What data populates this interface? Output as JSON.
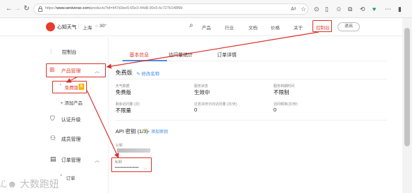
{
  "browser": {
    "url_prefix": "https://",
    "url_host": "www.seniverse.com",
    "url_path": "/products?id=447d3ee5-65e3-44d8-90c5-6c727b148f9b",
    "icons": [
      "back-icon",
      "forward-icon",
      "refresh-icon",
      "home-icon",
      "read-aloud-icon",
      "favorite-icon",
      "extension-icon",
      "split-screen-icon",
      "favorites-bar-icon",
      "collections-icon",
      "history-icon",
      "performance-icon",
      "more-icon",
      "sidebar-icon"
    ]
  },
  "header": {
    "logo_text": "心知天气",
    "separator": "|",
    "city": "上海",
    "weather_glyph": "☼",
    "temperature": "30°",
    "nav": [
      "产品",
      "行业",
      "文档",
      "价格",
      "关于",
      "控制台"
    ],
    "logout": "退出"
  },
  "sidebar": {
    "console": "控制台",
    "product_mgmt": "产品管理",
    "free_plan": "免费版",
    "free_badge": "免",
    "add_product": "+ 添加产品",
    "auth_upgrade": "认证升级",
    "members": "成员管理",
    "order_mgmt": "订单管理",
    "orders": "订单"
  },
  "tabs": [
    "基本信息",
    "访问量统计",
    "订单详情"
  ],
  "plan": {
    "title": "免费版",
    "edit": "✎ 修改名称",
    "fields": [
      {
        "label": "天气数据",
        "value": "免费版"
      },
      {
        "label": "服务状态",
        "value": "生效中"
      },
      {
        "label": "服务到期时间",
        "value": "不限制"
      },
      {
        "label": "剩余访问量 (次)",
        "value": "不限量"
      },
      {
        "label": "过去30天日均访问量 (次/天)",
        "value": "0"
      },
      {
        "label": "访问频率(次/秒)",
        "value": "0"
      }
    ]
  },
  "api": {
    "title": "API 密钥 (1/3)",
    "add": "+ 添加密钥",
    "public_label": "公钥",
    "private_label": "私钥",
    "private_value": "••••••••••••••••"
  },
  "watermark": "ℒ☻ 大数跑妞",
  "colors": {
    "accent": "#e63b2e",
    "link": "#3b8be0",
    "highlight": "#d9302c"
  }
}
